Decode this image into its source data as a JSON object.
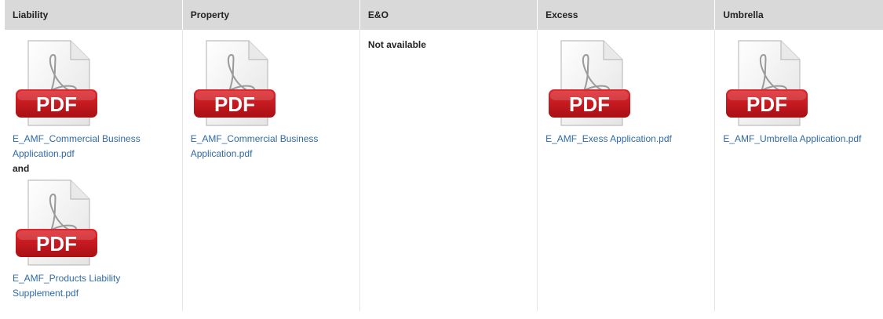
{
  "headers": [
    "Liability",
    "Property",
    "E&O",
    "Excess",
    "Umbrella"
  ],
  "icon": {
    "name": "pdf-file-icon",
    "label": "PDF",
    "badge_color": "#c4161c",
    "page_color": "#f4f4f4"
  },
  "columns": {
    "liability": {
      "file1": "E_AMF_Commercial Business Application.pdf",
      "and_text": "and",
      "file2": "E_AMF_Products Liability Supplement.pdf"
    },
    "property": {
      "file1": "E_AMF_Commercial Business Application.pdf"
    },
    "eo": {
      "status": "Not available"
    },
    "excess": {
      "file1": "E_AMF_Exess Application.pdf"
    },
    "umbrella": {
      "file1": "E_AMF_Umbrella Application.pdf"
    }
  },
  "colors": {
    "header_bg": "#d9d9d9",
    "link": "#2f6aa7"
  }
}
